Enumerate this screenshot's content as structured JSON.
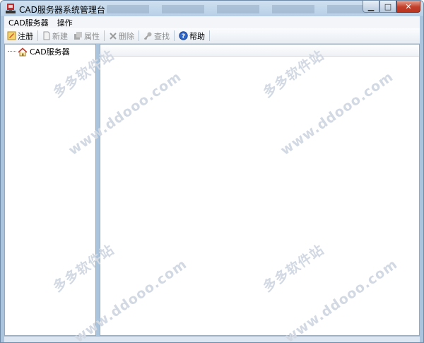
{
  "window": {
    "title": "CAD服务器系统管理台"
  },
  "menu": [
    {
      "label": "CAD服务器"
    },
    {
      "label": "操作"
    }
  ],
  "toolbar": {
    "register": "注册",
    "new": "新建",
    "properties": "属性",
    "delete": "删除",
    "find": "查找",
    "help": "帮助"
  },
  "tree": {
    "root": "CAD服务器"
  },
  "watermark": {
    "chinese": "多多软件站",
    "url": "www.ddooo.com"
  }
}
